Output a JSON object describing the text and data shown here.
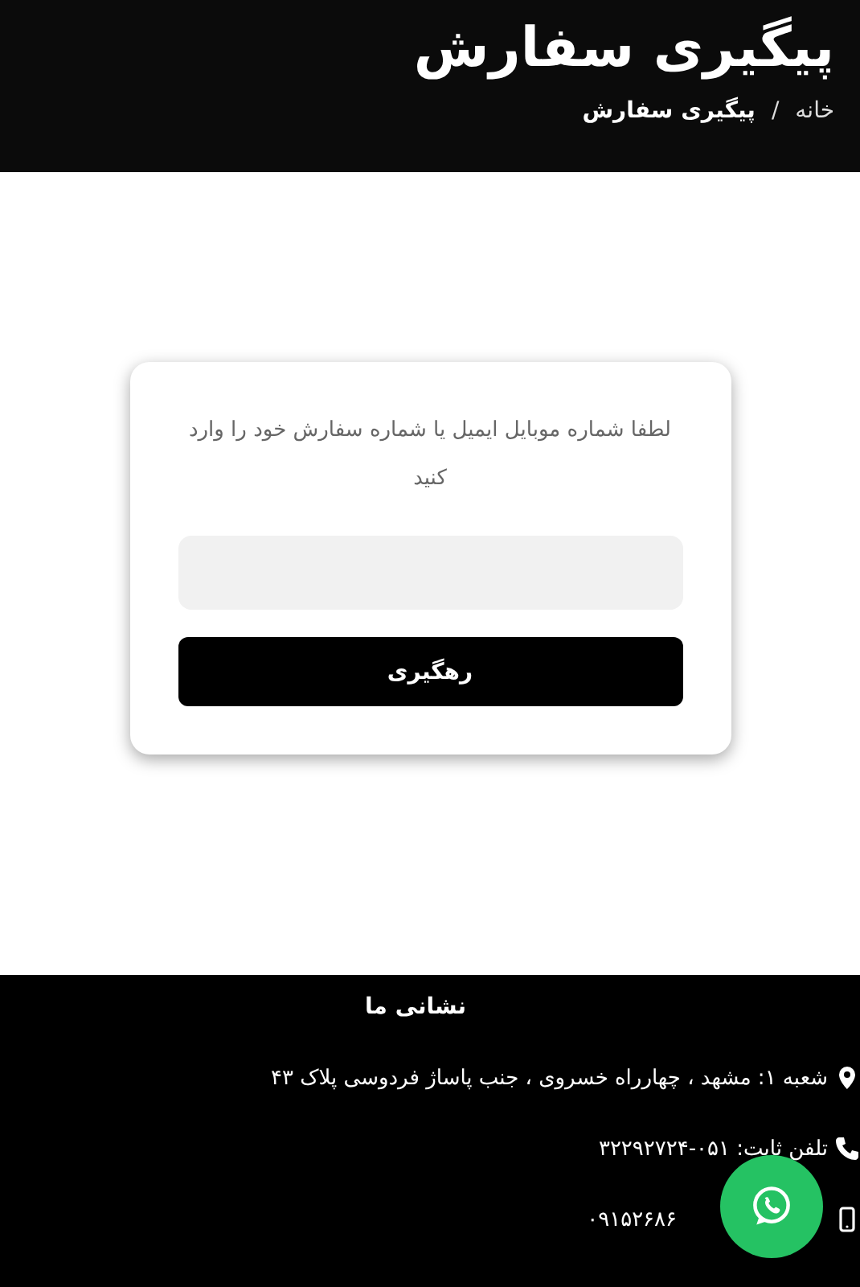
{
  "header": {
    "title": "پیگیری سفارش",
    "breadcrumb": [
      {
        "label": "خانه",
        "selected": false
      },
      {
        "label": "پیگیری سفارش",
        "selected": true
      }
    ],
    "separator": "/"
  },
  "tracking_form": {
    "prompt": "لطفا شماره موبایل ایمیل یا شماره سفارش خود را وارد کنید",
    "button": "رهگیری"
  },
  "footer": {
    "heading": "نشانی ما",
    "contacts": [
      {
        "kind": "location",
        "text": "شعبه ۱: مشهد ، چهارراه خسروی ، جنب پاساژ فردوسی پلاک ۴۳"
      },
      {
        "kind": "phone",
        "text": "تلفن ثابت: ۰۵۱-۳۲۲۹۲۷۲۴"
      },
      {
        "kind": "mobile",
        "text": "۰۹۱۵۲۶۸۶"
      }
    ]
  }
}
